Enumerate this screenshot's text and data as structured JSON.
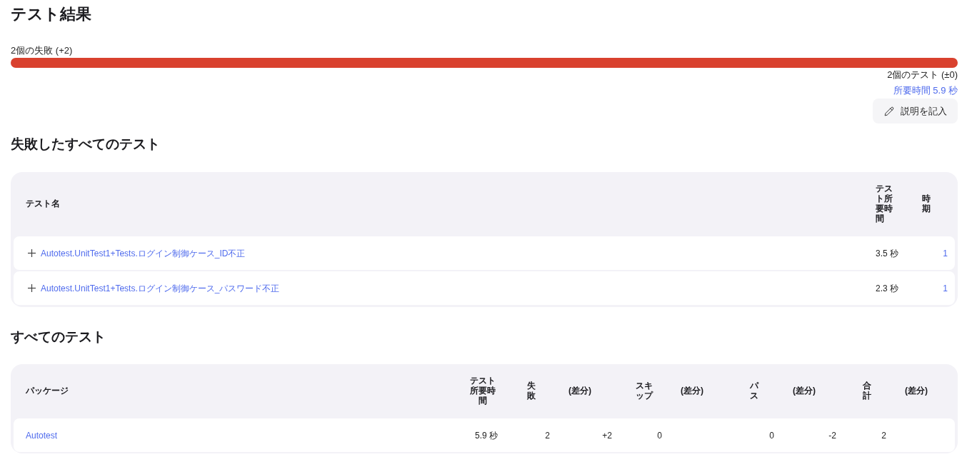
{
  "title": "テスト結果",
  "summary": {
    "failures_label": "2個の失敗 (+2)",
    "failure_bar": {
      "level": 1
    },
    "tests_label": "2個のテスト (±0)",
    "duration_link": "所要時間 5.9 秒",
    "describe_button": "説明を記入"
  },
  "failed_tests": {
    "heading": "失敗したすべてのテスト",
    "columns": [
      "テスト名",
      "テスト所要時間",
      "時期"
    ],
    "rows": [
      {
        "expanded": false,
        "name": "Autotest.UnitTest1+Tests.ログイン制御ケース_ID不正",
        "duration": "3.5 秒",
        "period": "1"
      },
      {
        "expanded": false,
        "name": "Autotest.UnitTest1+Tests.ログイン制御ケース_パスワード不正",
        "duration": "2.3 秒",
        "period": "1"
      }
    ]
  },
  "all_tests": {
    "heading": "すべてのテスト",
    "columns": [
      "パッケージ",
      "テスト所要時間",
      "失敗",
      "(差分)",
      "スキップ",
      "(差分)",
      "パス",
      "(差分)",
      "合計",
      "(差分)"
    ],
    "rows": [
      {
        "package": "Autotest",
        "duration": "5.9 秒",
        "failed": "2",
        "failed_diff": "+2",
        "skipped": "0",
        "passed": "0",
        "passed_diff": "-2",
        "total": "2"
      }
    ]
  }
}
